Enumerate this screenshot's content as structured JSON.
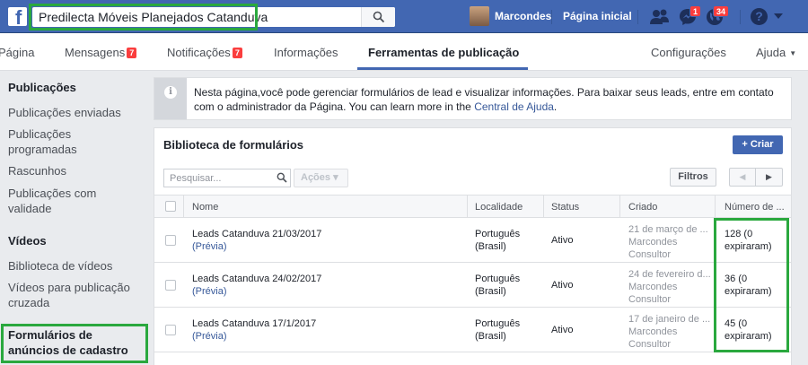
{
  "topbar": {
    "logo": "f",
    "search_value": "Predilecta Móveis Planejados Catanduva",
    "user_name": "Marcondes",
    "home_label": "Página inicial",
    "messages_badge": "1",
    "notifications_badge": "34",
    "help_label": "?"
  },
  "tabs": {
    "pagina": "Página",
    "mensagens": "Mensagens",
    "mensagens_badge": "7",
    "notificacoes": "Notificações",
    "notificacoes_badge": "7",
    "informacoes": "Informações",
    "ferramentas": "Ferramentas de publicação",
    "configuracoes": "Configurações",
    "ajuda": "Ajuda"
  },
  "sidebar": {
    "publicacoes_heading": "Publicações",
    "publicacoes_items": [
      "Publicações enviadas",
      "Publicações programadas",
      "Rascunhos",
      "Publicações com validade"
    ],
    "videos_heading": "Vídeos",
    "videos_items": [
      "Biblioteca de vídeos",
      "Vídeos para publicação cruzada"
    ],
    "formularios": "Formulários de anúncios de cadastro"
  },
  "info": {
    "text": "Nesta página,você pode gerenciar formulários de lead e visualizar informações. Para baixar seus leads, entre em contato com o administrador da Página. You can learn more in the ",
    "link": "Central de Ajuda",
    "end": "."
  },
  "library": {
    "title": "Biblioteca de formulários",
    "create_label": "+ Criar",
    "search_placeholder": "Pesquisar...",
    "actions_label": "Ações ▾",
    "filters_label": "Filtros",
    "pager_prev": "◀",
    "pager_next": "▶",
    "columns": [
      "Nome",
      "Localidade",
      "Status",
      "Criado",
      "Número de ..."
    ],
    "rows": [
      {
        "name": "Leads Catanduva 21/03/2017",
        "preview": "(Prévia)",
        "locale": "Português (Brasil)",
        "status": "Ativo",
        "created": "21 de março de ...",
        "creator": "Marcondes Consultor",
        "count": "128 (0 expiraram)"
      },
      {
        "name": "Leads Catanduva 24/02/2017",
        "preview": "(Prévia)",
        "locale": "Português (Brasil)",
        "status": "Ativo",
        "created": "24 de fevereiro d...",
        "creator": "Marcondes Consultor",
        "count": "36 (0 expiraram)"
      },
      {
        "name": "Leads Catanduva 17/1/2017",
        "preview": "(Prévia)",
        "locale": "Português (Brasil)",
        "status": "Ativo",
        "created": "17 de janeiro de ...",
        "creator": "Marcondes Consultor",
        "count": "45 (0 expiraram)"
      }
    ]
  },
  "colors": {
    "brand_blue": "#4267b2",
    "highlight_green": "#2aa83e",
    "badge_red": "#fa3e3e",
    "link_blue": "#365899"
  }
}
